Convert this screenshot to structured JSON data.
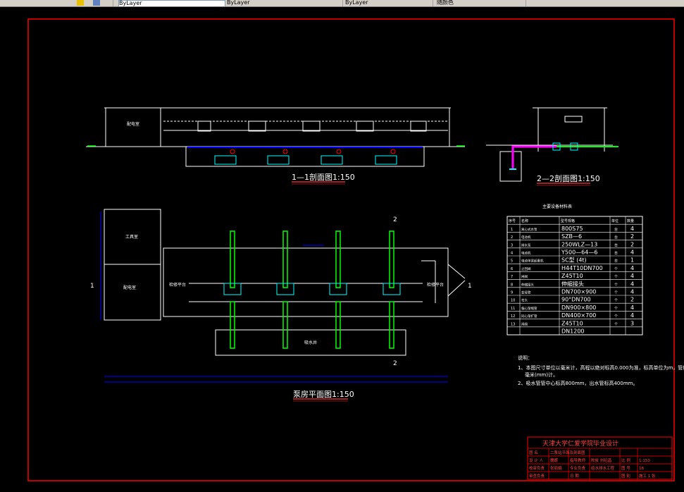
{
  "toolbar": {
    "cells": [
      "ByLayer",
      "ByLayer",
      "ByLayer",
      "随颜色"
    ]
  },
  "colors": {
    "background": "#000000",
    "border": "#ff0000",
    "lines": "#ffffff",
    "pipe": "#00ff00",
    "water": "#0000ff",
    "equipment": "#00ffff",
    "accent": "#ff00ff",
    "labels": "#ffffff",
    "title_underline": "#ff3333"
  },
  "drawing": {
    "section_1_1": {
      "title": "1—1剖面图1:150",
      "room_label": "配电室"
    },
    "section_2_2": {
      "title": "2—2剖面图1:150"
    },
    "plan": {
      "title": "泵房平面图1:150",
      "marker_left": "1",
      "marker_right": "1",
      "marker_top": "2",
      "marker_bottom": "2",
      "rooms": {
        "office": "工具室",
        "distribution": "配电室",
        "platform_left": "检修平台",
        "platform_right": "检修平台",
        "pool": "吸水井"
      }
    },
    "equipment_table": {
      "title": "主要设备材料表",
      "headers": [
        "序号",
        "名称",
        "型号规格",
        "单位",
        "数量"
      ],
      "rows": [
        {
          "no": "1",
          "name": "离心式水泵",
          "spec": "800S75",
          "unit": "台",
          "qty": "4"
        },
        {
          "no": "2",
          "name": "电动机",
          "spec": "SZB—6",
          "unit": "台",
          "qty": "2"
        },
        {
          "no": "3",
          "name": "排水泵",
          "spec": "250WLZ—13",
          "unit": "台",
          "qty": "2"
        },
        {
          "no": "4",
          "name": "电动机",
          "spec": "Y500—64—6",
          "unit": "台",
          "qty": "4"
        },
        {
          "no": "5",
          "name": "电动单梁起重机",
          "spec": "SC型 (4t)",
          "unit": "台",
          "qty": "1"
        },
        {
          "no": "6",
          "name": "止回阀",
          "spec": "H44T10DN700",
          "unit": "个",
          "qty": "4"
        },
        {
          "no": "7",
          "name": "闸阀",
          "spec": "Z45T10",
          "unit": "个",
          "qty": "4"
        },
        {
          "no": "8",
          "name": "伸缩接头",
          "spec": "伸缩接头",
          "unit": "个",
          "qty": "4"
        },
        {
          "no": "9",
          "name": "变径管",
          "spec": "DN700×900",
          "unit": "个",
          "qty": "4"
        },
        {
          "no": "10",
          "name": "弯头",
          "spec": "90°DN700",
          "unit": "个",
          "qty": "2"
        },
        {
          "no": "11",
          "name": "偏心渐缩管",
          "spec": "DN900×800",
          "unit": "个",
          "qty": "4"
        },
        {
          "no": "12",
          "name": "同心渐扩管",
          "spec": "DN400×700",
          "unit": "个",
          "qty": "4"
        },
        {
          "no": "13",
          "name": "闸阀",
          "spec": "Z45T10",
          "unit": "个",
          "qty": "3"
        },
        {
          "no": "",
          "name": "",
          "spec": "DN1200",
          "unit": "",
          "qty": ""
        }
      ]
    },
    "notes": {
      "heading": "说明：",
      "line1": "1、本图尺寸单位以毫米计，高程以绝对标高0.000为准，标高单位为m，管线尺寸以",
      "line1b": "毫米(mm)计。",
      "line2": "2、吸水管管中心标高800mm，出水管标高400mm。"
    },
    "title_block": {
      "school": "天津大学仁爱学院毕业设计",
      "rows": [
        [
          "图  名",
          "二泵站平面及剖面图",
          "",
          "",
          "",
          ""
        ],
        [
          "设 计 人",
          "魏娜",
          "指导教师",
          "陈俊  刘纪昌",
          "比 例",
          "1:150"
        ],
        [
          "校审负责",
          "张丽娟",
          "专业负责",
          "给水排水工程",
          "图 号",
          "18"
        ],
        [
          "审查负责",
          "",
          "日 期",
          "",
          "图 别",
          "施工  1  张"
        ]
      ]
    }
  }
}
